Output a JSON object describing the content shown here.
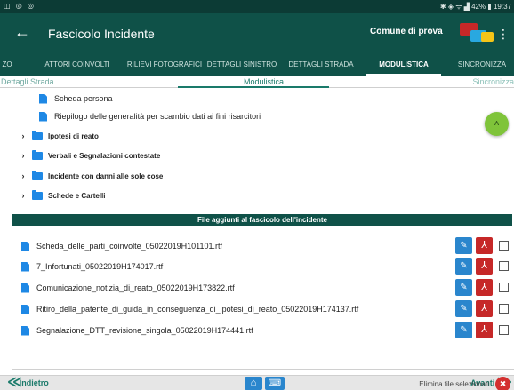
{
  "status": {
    "left_icons": "◫ ◎ ◎",
    "right": "✱ ◈ ᯤ ▟ 42% ▮ 19:37"
  },
  "appbar": {
    "back": "←",
    "title": "Fascicolo Incidente",
    "comune": "Comune di prova",
    "menu": "⋮"
  },
  "tabs": [
    {
      "label": "ZO"
    },
    {
      "label": "ATTORI COINVOLTI"
    },
    {
      "label": "RILIEVI FOTOGRAFICI"
    },
    {
      "label": "DETTAGLI SINISTRO"
    },
    {
      "label": "DETTAGLI STRADA"
    },
    {
      "label": "MODULISTICA"
    },
    {
      "label": "SINCRONIZZA"
    }
  ],
  "crumbs": {
    "prev": "Dettagli Strada",
    "current": "Modulistica",
    "next": "Sincronizza"
  },
  "sub_items": [
    {
      "label": "Scheda persona"
    },
    {
      "label": "Riepilogo delle generalità per scambio dati ai fini risarcitori"
    }
  ],
  "folders": [
    {
      "chevron": "›",
      "label": "Ipotesi di reato"
    },
    {
      "chevron": "›",
      "label": "Verbali e Segnalazioni contestate"
    },
    {
      "chevron": "›",
      "label": "Incidente con danni alle sole cose"
    },
    {
      "chevron": "›",
      "label": "Schede e Cartelli"
    }
  ],
  "fab": {
    "glyph": "˄"
  },
  "section_title": "File aggiunti al fascicolo dell'incidente",
  "files": [
    {
      "name": "Scheda_delle_parti_coinvolte_05022019H101101.rtf"
    },
    {
      "name": "7_Infortunati_05022019H174017.rtf"
    },
    {
      "name": "Comunicazione_notizia_di_reato_05022019H173822.rtf"
    },
    {
      "name": "Ritiro_della_patente_di_guida_in_conseguenza_di_ipotesi_di_reato_05022019H174137.rtf"
    },
    {
      "name": "Segnalazione_DTT_revisione_singola_05022019H174441.rtf"
    }
  ],
  "glyphs": {
    "edit": "✎",
    "pdf": "⅄",
    "delete": "✖",
    "home": "⌂",
    "keyboard": "⌨",
    "back_arrow": "≪",
    "fwd_arrow": "≫"
  },
  "elimina_label": "Elimina file selezionati",
  "nav": {
    "back": "Indietro",
    "forward": "Avanti"
  },
  "colors": {
    "primary": "#0f5148",
    "accent_green": "#7fc43a",
    "icon_blue": "#1e88e5",
    "edit_blue": "#2a86cd",
    "pdf_red": "#c62828"
  }
}
